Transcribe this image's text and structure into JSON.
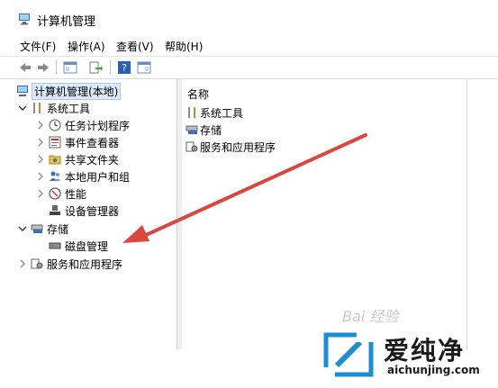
{
  "window": {
    "title": "计算机管理"
  },
  "menu": [
    {
      "label": "文件(F)"
    },
    {
      "label": "操作(A)"
    },
    {
      "label": "查看(V)"
    },
    {
      "label": "帮助(H)"
    }
  ],
  "toolbar": {
    "buttons": [
      "back-arrow-icon",
      "forward-arrow-icon",
      "show-hide-tree-icon",
      "export-list-icon",
      "help-icon",
      "properties-icon"
    ]
  },
  "tree": {
    "root": "计算机管理(本地)",
    "system_tools": "系统工具",
    "task_scheduler": "任务计划程序",
    "event_viewer": "事件查看器",
    "shared_folders": "共享文件夹",
    "local_users": "本地用户和组",
    "performance": "性能",
    "device_manager": "设备管理器",
    "storage": "存储",
    "disk_management": "磁盘管理",
    "services": "服务和应用程序"
  },
  "list": {
    "column_header": "名称",
    "items": [
      {
        "label": "系统工具"
      },
      {
        "label": "存储"
      },
      {
        "label": "服务和应用程序"
      }
    ]
  },
  "annotation": {
    "arrow_color": "#d9473f"
  },
  "watermarks": {
    "baidu": "Bai 经验",
    "brand_name": "爱纯净",
    "brand_url": "aichunjing.com"
  }
}
